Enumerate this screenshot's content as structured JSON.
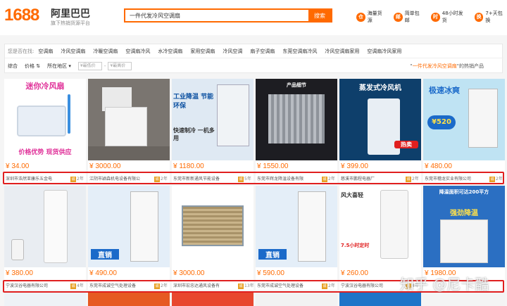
{
  "header": {
    "logo_number": "1688",
    "logo_name": "阿里巴巴",
    "logo_tagline": "旗下热销货源平台",
    "search_value": "一件代发冷风空调扇",
    "search_button": "搜索",
    "services": [
      {
        "icon": "warehouse-icon",
        "label": "海量货源"
      },
      {
        "icon": "package-icon",
        "label": "简单包邮"
      },
      {
        "icon": "clock-icon",
        "label": "48小时发货"
      },
      {
        "icon": "return-icon",
        "label": "7+天包换"
      }
    ]
  },
  "filters": {
    "location_label": "您是否在找:",
    "suggestions": [
      "空调扇",
      "冷风空调扇",
      "冷暖空调扇",
      "空调扇冷风",
      "水冷空调扇",
      "家用空调扇",
      "冷风空调",
      "扇子空调扇",
      "东莞空调扇冷风",
      "冷风空调扇家用",
      "空调扇冷风家用"
    ],
    "sort_items": [
      "综合",
      "价格",
      "所在地区"
    ],
    "price_min_placeholder": "¥最低价",
    "price_max_placeholder": "¥最高价",
    "price_separator": "-",
    "result_prefix": "\"",
    "result_keyword": "一件代发冷风空调扇",
    "result_suffix": "\"的热销产品"
  },
  "products_row1": [
    {
      "price": "¥ 34.00",
      "seller": "深圳市浩然亚康乐五金电",
      "years": "2年",
      "caption": "迷你冷风扇",
      "sub": "价格优势 现货供应"
    },
    {
      "price": "¥ 3000.00",
      "seller": "江阴市颖森机电设备有限公",
      "years": "2年",
      "caption": "",
      "sub": ""
    },
    {
      "price": "¥ 1180.00",
      "seller": "东莞市新新通风节能设备",
      "years": "5年",
      "caption": "工业降温 节能环保",
      "sub": "快速制冷 一机多用"
    },
    {
      "price": "¥ 1550.00",
      "seller": "东莞市辉龙降温设备有限",
      "years": "2年",
      "caption": "产品细节",
      "sub": ""
    },
    {
      "price": "¥ 399.00",
      "seller": "慈溪市鹏程电器厂",
      "years": "2年",
      "caption": "蒸发式冷风机",
      "sub": "热卖"
    },
    {
      "price": "¥ 480.00",
      "seller": "东莞市穗龙实业有限公司",
      "years": "2年",
      "caption": "极速冰爽",
      "sub": "¥520"
    }
  ],
  "products_row2": [
    {
      "price": "¥ 380.00",
      "seller": "宁波汉谷电器有限公司",
      "years": "4年",
      "caption": "",
      "sub": ""
    },
    {
      "price": "¥ 490.00",
      "seller": "东莞市成诚空气处理设备",
      "years": "2年",
      "caption": "直销",
      "sub": ""
    },
    {
      "price": "¥ 3000.00",
      "seller": "深圳市宏忠达通风设备有",
      "years": "13年",
      "caption": "",
      "sub": ""
    },
    {
      "price": "¥ 590.00",
      "seller": "东莞市成诚空气处理设备",
      "years": "2年",
      "caption": "直销",
      "sub": ""
    },
    {
      "price": "¥ 260.00",
      "seller": "宁波汉谷电器有限公司",
      "years": "4年",
      "caption": "风大喜轻",
      "sub": "7.5小时定时"
    },
    {
      "price": "¥ 1980.00",
      "seller": "",
      "years": "",
      "caption": "降温面积可达200平方",
      "sub": "强劲降温"
    }
  ],
  "watermark": "知乎 @尼卡酷",
  "colors": {
    "brand": "#ff6a00",
    "highlight": "#e01f1f",
    "badge": "#e8a024"
  }
}
